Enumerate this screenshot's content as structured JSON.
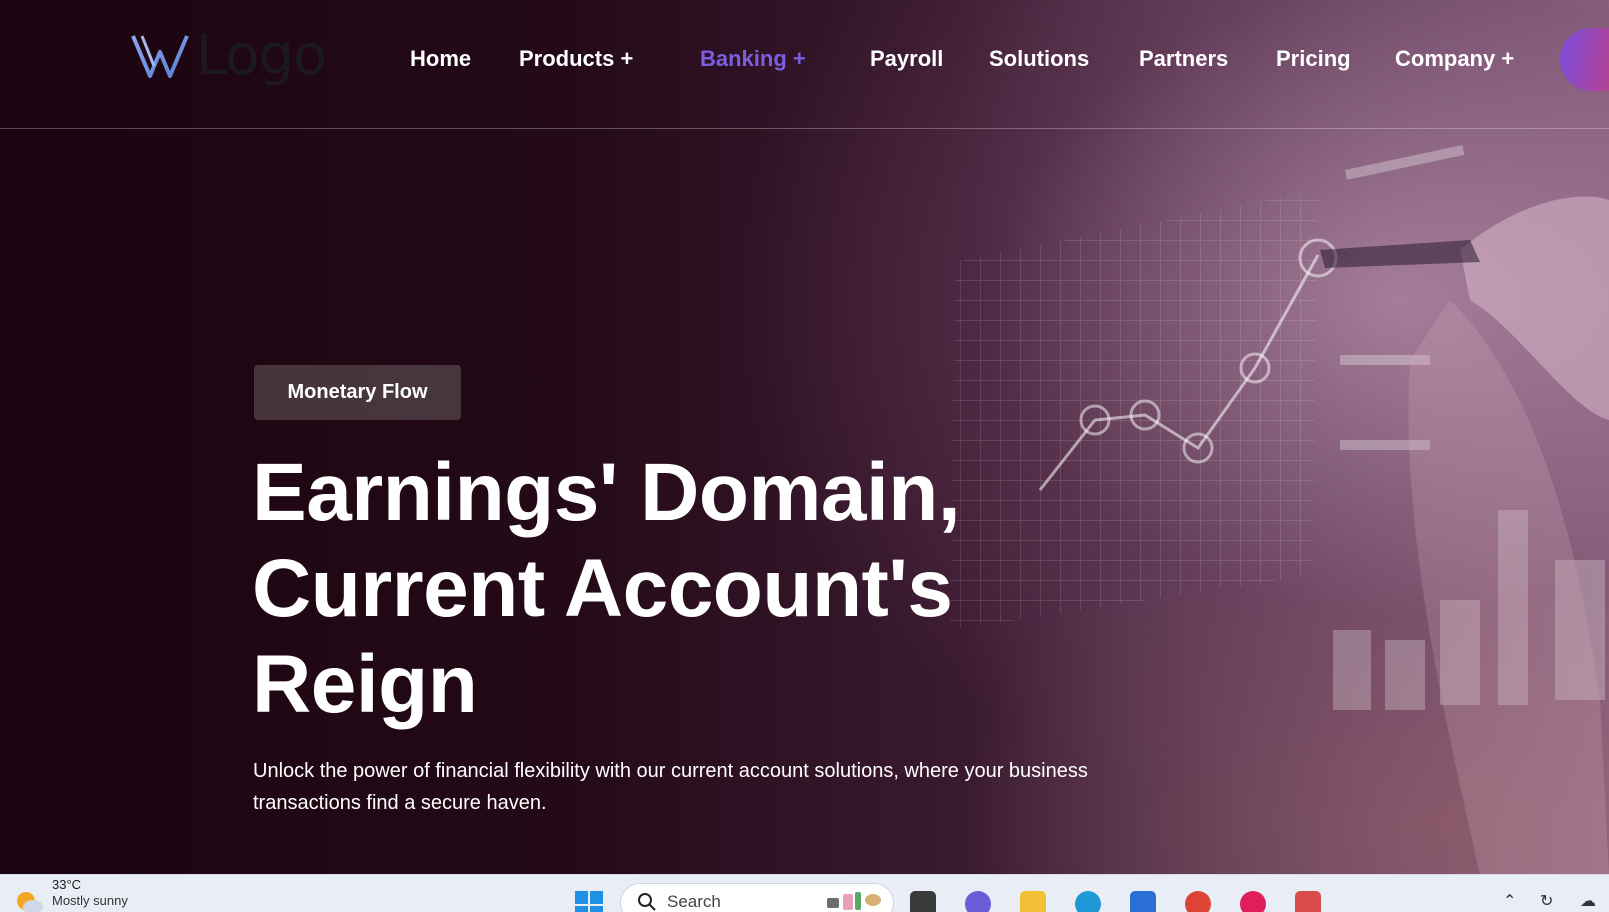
{
  "logo": {
    "text": "Logo"
  },
  "nav": {
    "items": [
      {
        "label": "Home"
      },
      {
        "label": "Products +"
      },
      {
        "label": "Banking +"
      },
      {
        "label": "Payroll"
      },
      {
        "label": "Solutions"
      },
      {
        "label": "Partners"
      },
      {
        "label": "Pricing"
      },
      {
        "label": "Company +"
      }
    ],
    "active": "Banking +"
  },
  "hero": {
    "badge": "Monetary Flow",
    "headline": [
      "Earnings' Domain,",
      "Current Account's",
      "Reign"
    ],
    "subtitle": "Unlock the power of financial flexibility with our current account solutions, where your business transactions find a secure haven."
  },
  "taskbar": {
    "weather": {
      "temp": "33°C",
      "condition": "Mostly sunny"
    },
    "search_label": "Search",
    "icons": [
      "windows-start-icon",
      "task-view-icon",
      "teams-icon",
      "file-explorer-icon",
      "edge-icon",
      "store-icon",
      "chrome-icon",
      "slack-icon",
      "snipping-tool-icon"
    ]
  },
  "colors": {
    "accent": "#7b5de0",
    "cta_gradient_start": "#7b4ee0",
    "cta_gradient_end": "#d23b6a",
    "badge_bg": "#4e3e42"
  }
}
